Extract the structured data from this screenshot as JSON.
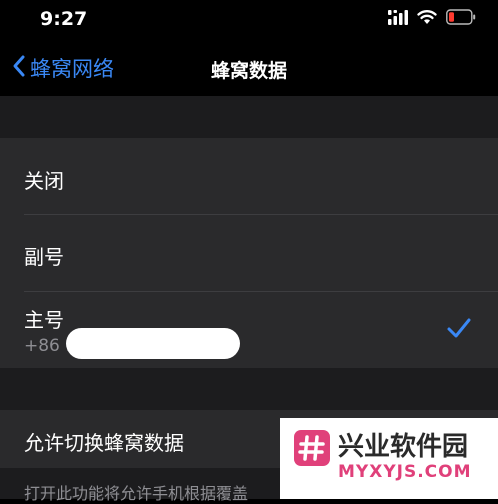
{
  "status_bar": {
    "time": "9:27",
    "icons": [
      "cellular-signal-icon",
      "wifi-icon",
      "battery-low-icon"
    ],
    "battery_color": "#ff3b30"
  },
  "nav": {
    "back_label": "蜂窝网络",
    "title": "蜂窝数据",
    "accent_color": "#3a88f5"
  },
  "options": [
    {
      "label": "关闭",
      "selected": false
    },
    {
      "label": "副号",
      "selected": false
    },
    {
      "label": "主号",
      "sublabel": "+86 1",
      "selected": true
    }
  ],
  "switch_row": {
    "label": "允许切换蜂窝数据",
    "on": true,
    "footer": "打开此功能将允许手机根据覆盖"
  },
  "watermark": {
    "title": "兴业软件园",
    "url": "MYXYJS.COM",
    "logo_glyph": "#"
  }
}
